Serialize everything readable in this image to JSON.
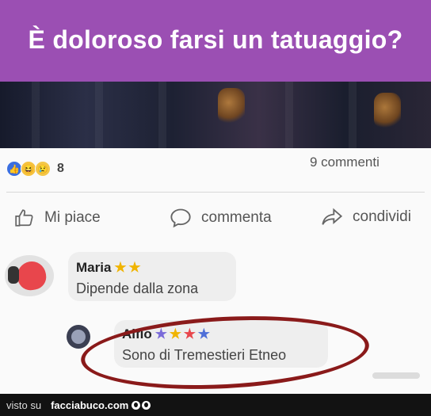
{
  "post": {
    "title": "È doloroso farsi un tatuaggio?",
    "header_color": "#9b4fb3"
  },
  "reactions": {
    "icons": [
      "like-icon",
      "haha-icon",
      "sad-icon"
    ],
    "count": "8",
    "comments": "9 commenti"
  },
  "actions": [
    {
      "label": "Mi piace",
      "icon": "thumbs-up-icon"
    },
    {
      "label": "commenta",
      "icon": "comment-icon"
    },
    {
      "label": "condividi",
      "icon": "share-icon"
    }
  ],
  "comments": [
    {
      "name": "Maria",
      "text": "Dipende dalla zona"
    },
    {
      "name": "Alfio",
      "text": "Sono di Tremestieri Etneo"
    }
  ],
  "footer": {
    "seen_on": "visto su",
    "site": "facciabuco.com"
  }
}
